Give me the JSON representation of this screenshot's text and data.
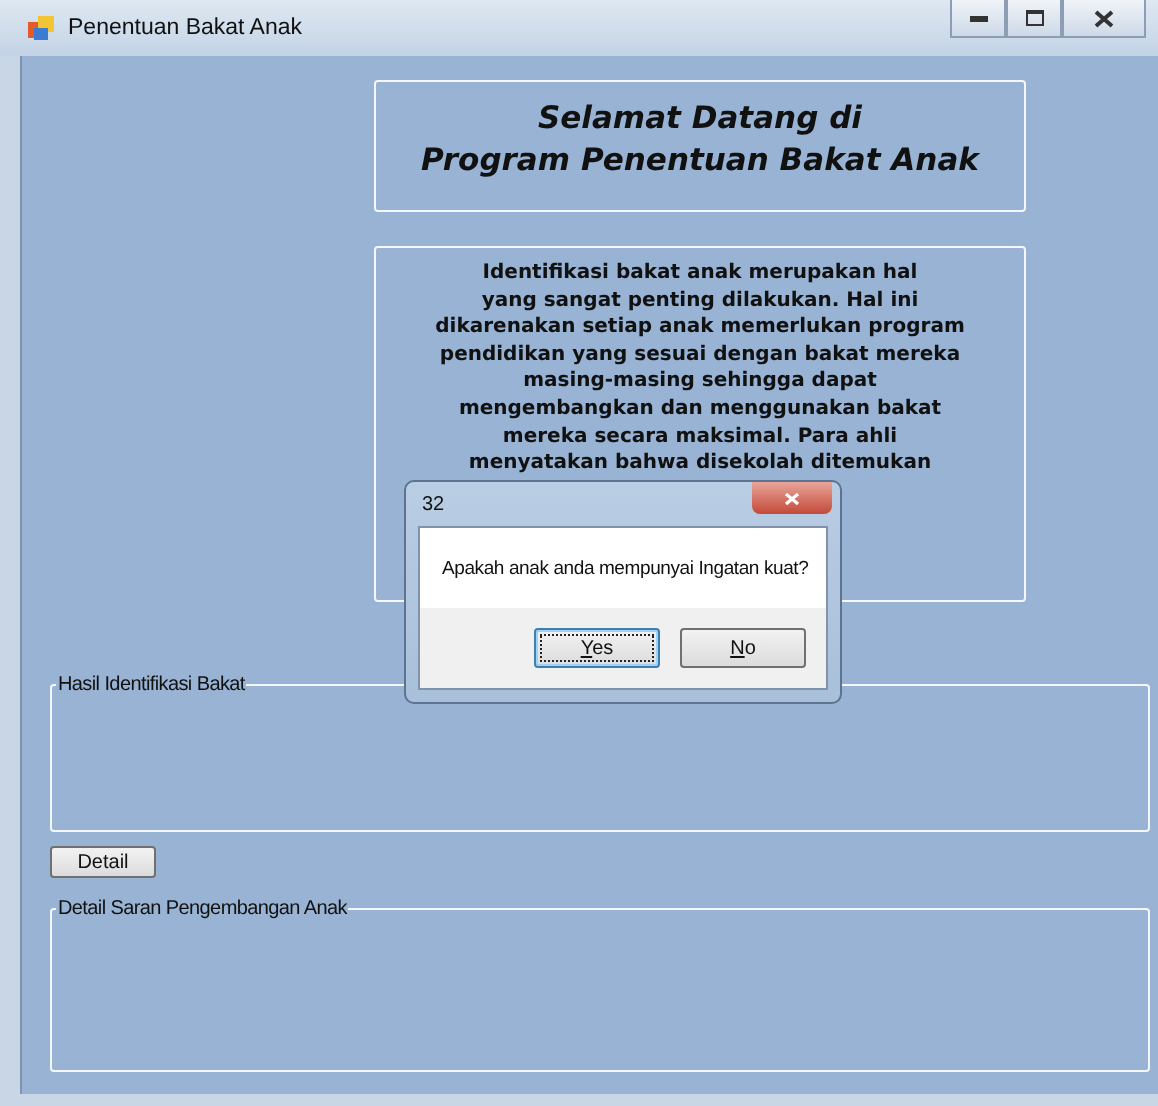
{
  "window": {
    "title": "Penentuan Bakat Anak"
  },
  "welcome": {
    "lines": [
      "Selamat Datang di",
      "Program Penentuan Bakat Anak"
    ]
  },
  "intro": {
    "lines": [
      "Identifikasi bakat anak merupakan hal",
      "yang sangat penting dilakukan. Hal ini",
      "dikarenakan setiap anak memerlukan program",
      "pendidikan yang sesuai dengan bakat mereka",
      "masing-masing sehingga dapat",
      "mengembangkan dan menggunakan bakat",
      "mereka secara maksimal. Para ahli",
      "menyatakan bahwa disekolah ditemukan"
    ]
  },
  "result_group": {
    "title": "Hasil Identifikasi Bakat"
  },
  "detail_button": {
    "label": "Detail"
  },
  "advice_group": {
    "title": "Detail Saran Pengembangan Anak"
  },
  "dialog": {
    "title": "32",
    "message": "Apakah anak anda mempunyai Ingatan kuat?",
    "buttons": [
      {
        "label": "Yes",
        "focused": true
      },
      {
        "label": "No",
        "focused": false
      }
    ]
  }
}
